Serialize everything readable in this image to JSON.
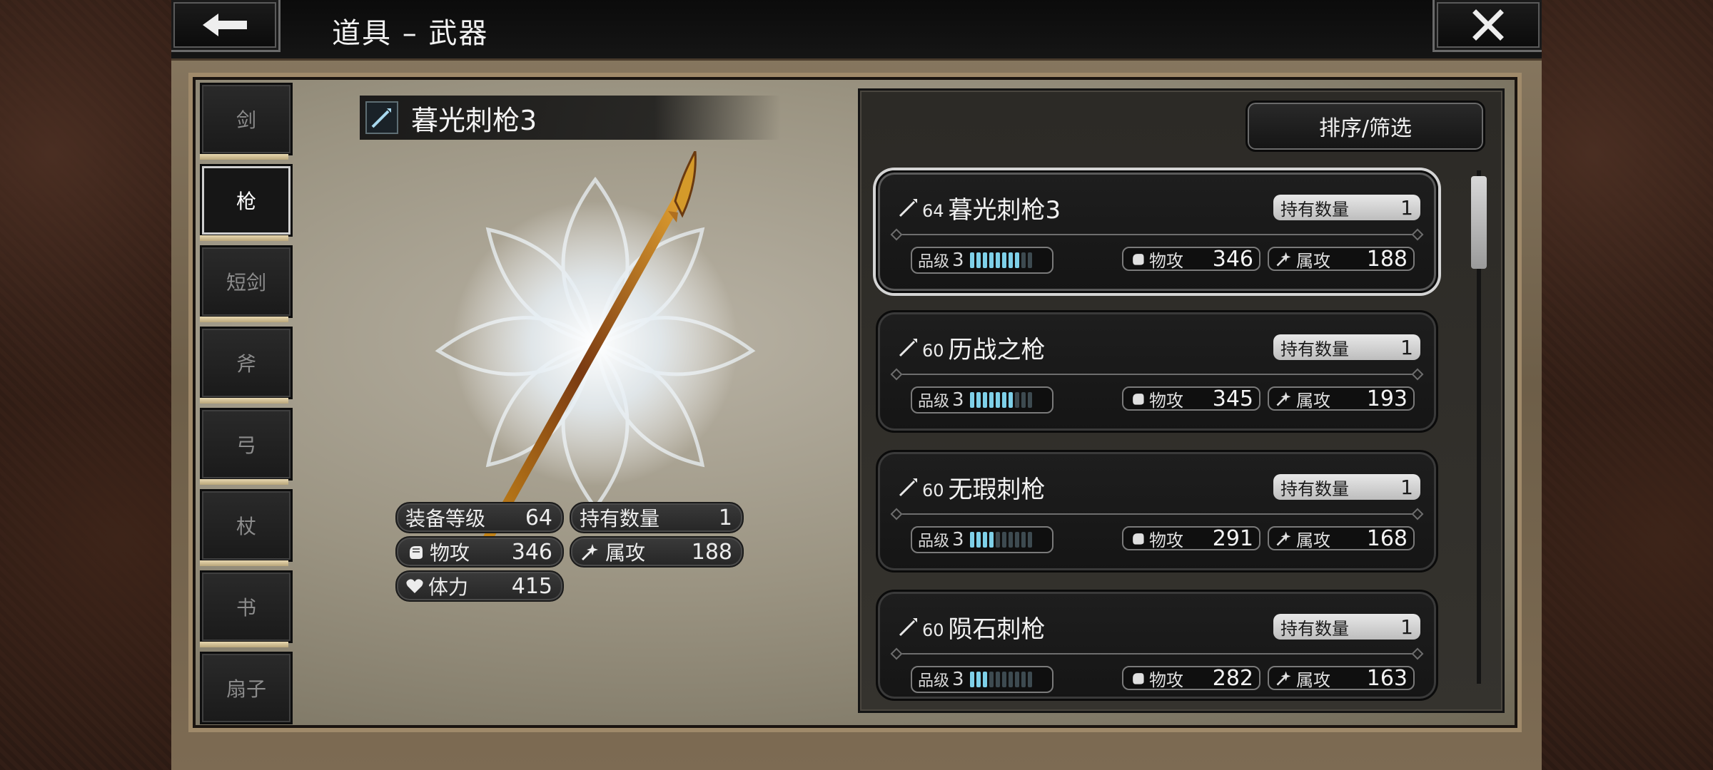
{
  "header": {
    "title": "道具 – 武器"
  },
  "tabs": [
    {
      "label": "剑",
      "active": false
    },
    {
      "label": "枪",
      "active": true
    },
    {
      "label": "短剑",
      "active": false
    },
    {
      "label": "斧",
      "active": false
    },
    {
      "label": "弓",
      "active": false
    },
    {
      "label": "杖",
      "active": false
    },
    {
      "label": "书",
      "active": false
    },
    {
      "label": "扇子",
      "active": false
    }
  ],
  "detail": {
    "name": "暮光刺枪3",
    "equip_level_label": "装备等级",
    "equip_level": "64",
    "quantity_label": "持有数量",
    "quantity": "1",
    "phys_atk_label": "物攻",
    "phys_atk": "346",
    "elem_atk_label": "属攻",
    "elem_atk": "188",
    "hp_label": "体力",
    "hp": "415"
  },
  "list": {
    "sort_label": "排序/筛选",
    "qty_label": "持有数量",
    "grade_label": "品级",
    "phys_label": "物攻",
    "elem_label": "属攻",
    "items": [
      {
        "level": "64",
        "name": "暮光刺枪3",
        "qty": "1",
        "grade": "3",
        "grade_fill": 8,
        "phys": "346",
        "elem": "188",
        "selected": true
      },
      {
        "level": "60",
        "name": "历战之枪",
        "qty": "1",
        "grade": "3",
        "grade_fill": 7,
        "phys": "345",
        "elem": "193",
        "selected": false
      },
      {
        "level": "60",
        "name": "无瑕刺枪",
        "qty": "1",
        "grade": "3",
        "grade_fill": 4,
        "phys": "291",
        "elem": "168",
        "selected": false
      },
      {
        "level": "60",
        "name": "陨石刺枪",
        "qty": "1",
        "grade": "3",
        "grade_fill": 3,
        "phys": "282",
        "elem": "163",
        "selected": false
      }
    ]
  },
  "icons": {
    "back": "arrow-left-icon",
    "close": "close-x-icon",
    "spear": "spear-icon",
    "fist": "fist-icon",
    "magic": "magic-sparkle-icon",
    "heart": "heart-icon"
  },
  "colors": {
    "grade_fill": "#7ed0e8",
    "selected_border": "#d4d4d4"
  }
}
